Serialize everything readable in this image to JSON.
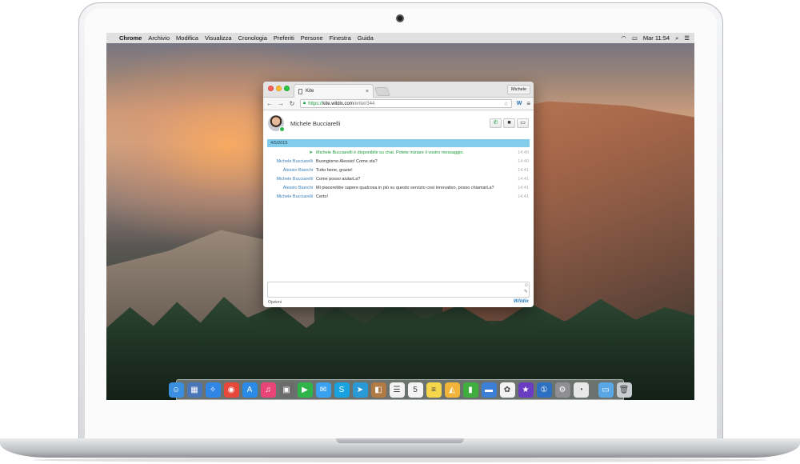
{
  "menubar": {
    "app_name": "Chrome",
    "items": [
      "Archivio",
      "Modifica",
      "Visualizza",
      "Cronologia",
      "Preferiti",
      "Persone",
      "Finestra",
      "Guida"
    ],
    "clock": "Mar 11:54"
  },
  "browser": {
    "tab_title": "Kite",
    "profile_name": "Michele",
    "url_scheme": "https://",
    "url_host": "kite.wildix.com",
    "url_path": "/eritel/344"
  },
  "chat": {
    "contact_name": "Michele Bucciarelli",
    "date": "4/5/2015",
    "messages": [
      {
        "sender": "",
        "text": "Michele Bucciarelli è disponibile su chat. Potete iniziare il vostro messaggio.",
        "time": "14:40",
        "system": true
      },
      {
        "sender": "Michele Bucciarelli",
        "text": "Buongiorno Alessio! Come sta?",
        "time": "14:40"
      },
      {
        "sender": "Alessio Bianchi",
        "text": "Tutto bene, grazie!",
        "time": "14:41"
      },
      {
        "sender": "Michele Bucciarelli",
        "text": "Come posso aiutarLa?",
        "time": "14:41"
      },
      {
        "sender": "Alessio Bianchi",
        "text": "Mi piacerebbe sapere qualcosa in più su questo servizio così innovativo, posso chiamarLa?",
        "time": "14:41"
      },
      {
        "sender": "Michele Bucciarelli",
        "text": "Certo!",
        "time": "14:41"
      }
    ],
    "options_label": "Opzioni",
    "brand": "Wildix"
  },
  "dock": {
    "apps": [
      {
        "name": "finder-icon",
        "color": "#3b8fe0",
        "glyph": "☺"
      },
      {
        "name": "preview-icon",
        "color": "#4a76b8",
        "glyph": "▦"
      },
      {
        "name": "safari-icon",
        "color": "#2f86e6",
        "glyph": "✧"
      },
      {
        "name": "chrome-icon",
        "color": "#e8473b",
        "glyph": "◉"
      },
      {
        "name": "app-store-icon",
        "color": "#2a8ae8",
        "glyph": "A"
      },
      {
        "name": "itunes-icon",
        "color": "#e8447a",
        "glyph": "♫"
      },
      {
        "name": "photo-booth-icon",
        "color": "#6b6b6b",
        "glyph": "▣"
      },
      {
        "name": "facetime-icon",
        "color": "#2fb44a",
        "glyph": "▶"
      },
      {
        "name": "messages-icon",
        "color": "#3aa0f0",
        "glyph": "✉"
      },
      {
        "name": "skype-icon",
        "color": "#18a2e0",
        "glyph": "S"
      },
      {
        "name": "telegram-icon",
        "color": "#2a9ad6",
        "glyph": "➤"
      },
      {
        "name": "contacts-icon",
        "color": "#b07a45",
        "glyph": "◧"
      },
      {
        "name": "reminders-icon",
        "color": "#f2f2f2",
        "glyph": "☰"
      },
      {
        "name": "calendar-icon",
        "color": "#f4f4f4",
        "glyph": "5"
      },
      {
        "name": "notes-icon",
        "color": "#f5d64a",
        "glyph": "≡"
      },
      {
        "name": "keynote-icon",
        "color": "#f0b43a",
        "glyph": "◭"
      },
      {
        "name": "numbers-icon",
        "color": "#3fae3f",
        "glyph": "▮"
      },
      {
        "name": "keynote-remote-icon",
        "color": "#3b7fd6",
        "glyph": "▬"
      },
      {
        "name": "photos-icon",
        "color": "#f2f2f2",
        "glyph": "✿"
      },
      {
        "name": "imovie-icon",
        "color": "#6a3cc2",
        "glyph": "★"
      },
      {
        "name": "onepassword-icon",
        "color": "#2d6fc0",
        "glyph": "①"
      },
      {
        "name": "system-preferences-icon",
        "color": "#8e8e93",
        "glyph": "⚙"
      },
      {
        "name": "other-app-icon",
        "color": "#e8e8e8",
        "glyph": "◔"
      }
    ],
    "trailing": [
      {
        "name": "downloads-folder-icon",
        "color": "#5aa7e6",
        "glyph": "▭"
      },
      {
        "name": "trash-icon",
        "color": "#c9ccd1",
        "glyph": "🗑"
      }
    ]
  }
}
